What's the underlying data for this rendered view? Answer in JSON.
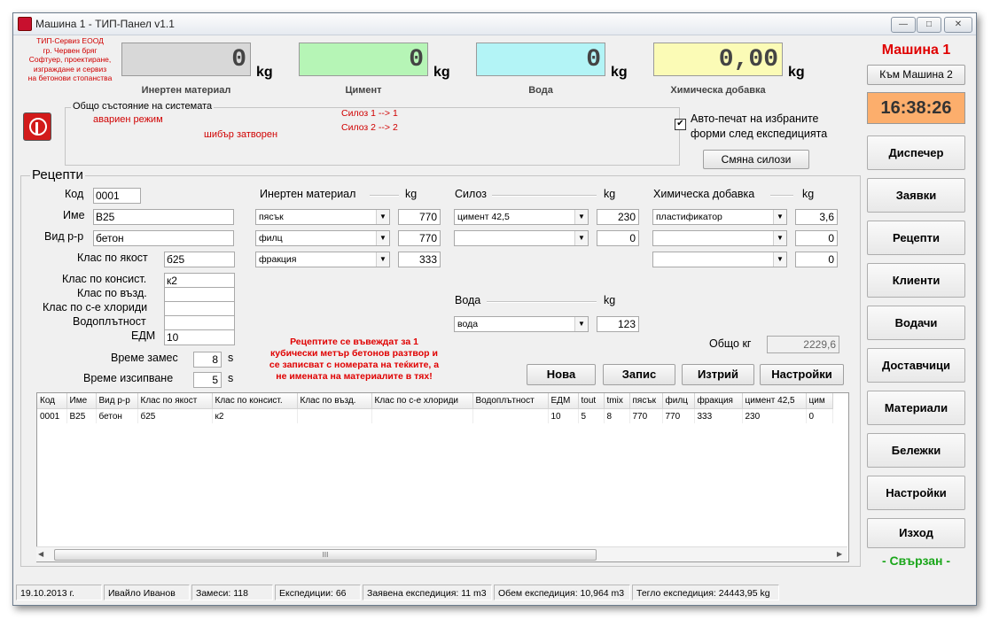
{
  "window": {
    "title": "Машина 1 - ТИП-Панел v1.1"
  },
  "company": {
    "lines": [
      "ТИП-Сервиз   ЕООД",
      "гр. Червен бряг",
      "Софтуер, проектиране,",
      "изграждане и сервиз",
      "на бетонови стопанства"
    ]
  },
  "displays": [
    {
      "value": "0",
      "unit": "kg",
      "label": "Инертен материал",
      "color": "#d8d8d8"
    },
    {
      "value": "0",
      "unit": "kg",
      "label": "Цимент",
      "color": "#b6f5b6"
    },
    {
      "value": "0",
      "unit": "kg",
      "label": "Вода",
      "color": "#b3f4f6"
    },
    {
      "value": "0,00",
      "unit": "kg",
      "label": "Химическа добавка",
      "color": "#fbfbb6"
    }
  ],
  "machine": {
    "title": "Машина 1",
    "switch_label": "Към Машина 2",
    "clock": "16:38:26",
    "status": "- Свързан -"
  },
  "system_status": {
    "title": "Общо състояние на системата",
    "emergency": "авариен режим",
    "gate": "шибър затворен",
    "silo1": "Силоз 1 -->   1",
    "silo2": "Силоз 2 -->   2"
  },
  "autoprint": {
    "line1": "Авто-печат на избраните",
    "line2": "форми след експедицията",
    "checked": "✔"
  },
  "swap_silos_label": "Смяна силози",
  "nav": [
    "Диспечер",
    "Заявки",
    "Рецепти",
    "Клиенти",
    "Водачи",
    "Доставчици",
    "Материали",
    "Бележки",
    "Настройки",
    "Изход"
  ],
  "recipe": {
    "section_title": "Рецепти",
    "fields": {
      "code": {
        "label": "Код",
        "value": "0001"
      },
      "name": {
        "label": "Име",
        "value": "B25"
      },
      "type": {
        "label": "Вид р-р",
        "value": "бетон"
      },
      "strength": {
        "label": "Клас по якост",
        "value": "б25"
      },
      "consistency": {
        "label": "Клас по консист.",
        "value": "к2"
      },
      "air": {
        "label": "Клас по възд.",
        "value": ""
      },
      "chlorides": {
        "label": "Клас по с-е хлориди",
        "value": ""
      },
      "watertight": {
        "label": "Водоплътност",
        "value": ""
      },
      "edm": {
        "label": "ЕДМ",
        "value": "10"
      }
    },
    "mix_time": {
      "label": "Време замес",
      "value": "8",
      "unit": "s"
    },
    "pour_time": {
      "label": "Време изсипване",
      "value": "5",
      "unit": "s"
    },
    "aggregate": {
      "title": "Инертен материал",
      "unit": "kg",
      "rows": [
        {
          "material": "пясък",
          "value": "770"
        },
        {
          "material": "филц",
          "value": "770"
        },
        {
          "material": "фракция",
          "value": "333"
        }
      ]
    },
    "silo": {
      "title": "Силоз",
      "unit": "kg",
      "rows": [
        {
          "material": "цимент 42,5",
          "value": "230"
        },
        {
          "material": "",
          "value": "0"
        }
      ]
    },
    "chemical": {
      "title": "Химическа добавка",
      "unit": "kg",
      "rows": [
        {
          "material": "пластификатор",
          "value": "3,6"
        },
        {
          "material": "",
          "value": "0"
        },
        {
          "material": "",
          "value": "0"
        }
      ]
    },
    "water": {
      "title": "Вода",
      "unit": "kg",
      "material": "вода",
      "value": "123"
    },
    "total": {
      "label": "Общо кг",
      "value": "2229,6"
    },
    "notice": [
      "Рецептите се въвеждат за 1",
      "кубически метър бетонов разтвор и",
      "се записват с номерата на теќките, а",
      "не имената на материалите в тях!"
    ],
    "buttons": {
      "new": "Нова",
      "save": "Запис",
      "delete": "Изтрий",
      "settings": "Настройки"
    }
  },
  "table": {
    "columns": [
      "Код",
      "Име",
      "Вид р-р",
      "Клас по якост",
      "Клас по консист.",
      "Клас по възд.",
      "Клас по с-е хлориди",
      "Водоплътност",
      "ЕДМ",
      "tout",
      "tmix",
      "пясък",
      "филц",
      "фракция",
      "цимент 42,5",
      "цим"
    ],
    "rows": [
      [
        "0001",
        "B25",
        "бетон",
        "б25",
        "к2",
        "",
        "",
        "",
        "10",
        "5",
        "8",
        "770",
        "770",
        "333",
        "230",
        "0"
      ]
    ],
    "scroll_mark": "III"
  },
  "statusbar": {
    "date": "19.10.2013 г.",
    "user": "Ивайло Иванов",
    "batches": "Замеси: 118",
    "expeditions": "Експедиции: 66",
    "requested": "Заявена експедиция: 11 m3",
    "volume": "Обем експедиция: 10,964 m3",
    "weight": "Тегло експедиция: 24443,95 kg"
  }
}
